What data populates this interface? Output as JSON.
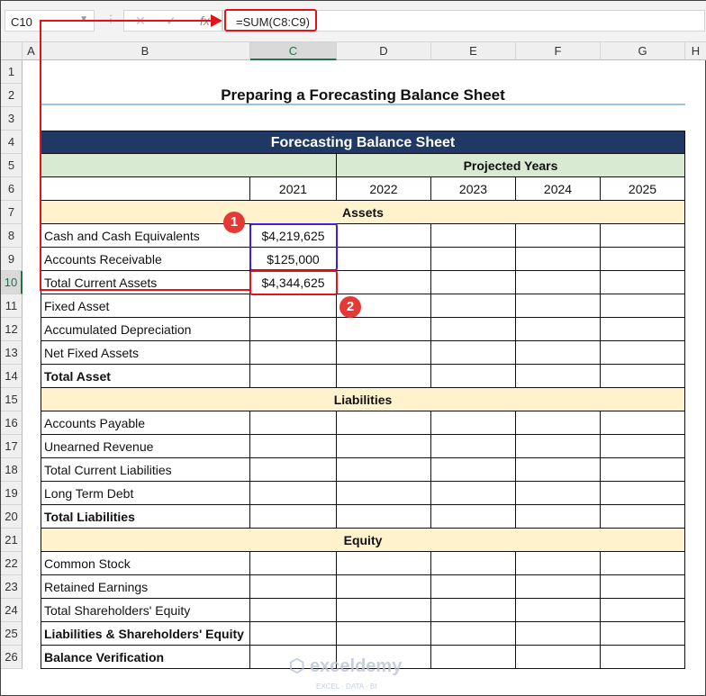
{
  "formula_bar": {
    "name_box": "C10",
    "cancel_icon": "✕",
    "enter_icon": "✓",
    "fx_label": "fx",
    "formula": "=SUM(C8:C9)"
  },
  "columns": [
    "A",
    "B",
    "C",
    "D",
    "E",
    "F",
    "G",
    "H"
  ],
  "selected_column": "C",
  "selected_row": 10,
  "title": "Preparing a Forecasting Balance Sheet",
  "table": {
    "banner": "Forecasting Balance Sheet",
    "projected_header": "Projected Years",
    "years": [
      "2021",
      "2022",
      "2023",
      "2024",
      "2025"
    ],
    "sections": {
      "assets": "Assets",
      "liabilities": "Liabilities",
      "equity": "Equity"
    },
    "rows": [
      {
        "row": 8,
        "label": "Cash and Cash Equivalents",
        "bold": false,
        "c": "$4,219,625"
      },
      {
        "row": 9,
        "label": "Accounts Receivable",
        "bold": false,
        "c": "$125,000"
      },
      {
        "row": 10,
        "label": "Total Current Assets",
        "bold": false,
        "c": "$4,344,625"
      },
      {
        "row": 11,
        "label": "Fixed Asset",
        "bold": false
      },
      {
        "row": 12,
        "label": "Accumulated Depreciation",
        "bold": false
      },
      {
        "row": 13,
        "label": "Net Fixed Assets",
        "bold": false
      },
      {
        "row": 14,
        "label": "Total Asset",
        "bold": true
      },
      {
        "row": 16,
        "label": "Accounts Payable",
        "bold": false
      },
      {
        "row": 17,
        "label": "Unearned Revenue",
        "bold": false
      },
      {
        "row": 18,
        "label": "Total Current Liabilities",
        "bold": false
      },
      {
        "row": 19,
        "label": "Long Term Debt",
        "bold": false
      },
      {
        "row": 20,
        "label": "Total Liabilities",
        "bold": true
      },
      {
        "row": 22,
        "label": "Common Stock",
        "bold": false
      },
      {
        "row": 23,
        "label": "Retained Earnings",
        "bold": false
      },
      {
        "row": 24,
        "label": "Total Shareholders' Equity",
        "bold": false
      },
      {
        "row": 25,
        "label": "Liabilities & Shareholders' Equity",
        "bold": true
      },
      {
        "row": 26,
        "label": "Balance Verification",
        "bold": true
      }
    ]
  },
  "annotations": {
    "step1": "1",
    "step2": "2",
    "arrow_color": "#e0141a",
    "range_box_color": "#3d1ef0"
  },
  "watermark": {
    "name": "exceldemy",
    "tagline": "EXCEL · DATA · BI"
  }
}
